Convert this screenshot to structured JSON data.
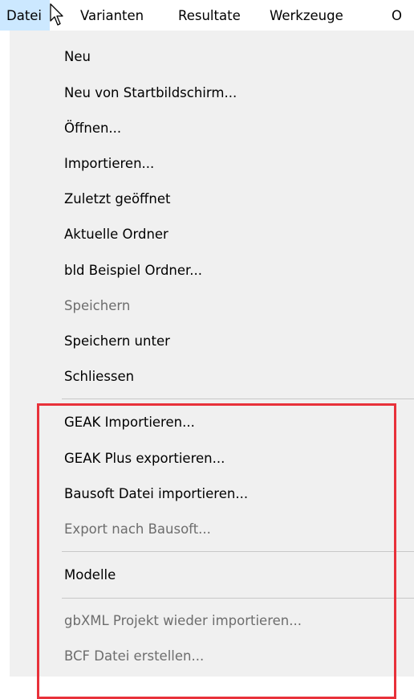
{
  "menubar": {
    "items": [
      {
        "label": "Datei"
      },
      {
        "label": "Varianten"
      },
      {
        "label": "Resultate"
      },
      {
        "label": "Werkzeuge"
      },
      {
        "label": "O"
      }
    ]
  },
  "dropdown": {
    "items": [
      {
        "label": "Neu",
        "enabled": true
      },
      {
        "label": "Neu von Startbildschirm...",
        "enabled": true
      },
      {
        "label": "Öffnen...",
        "enabled": true
      },
      {
        "label": "Importieren...",
        "enabled": true
      },
      {
        "label": "Zuletzt geöffnet",
        "enabled": true
      },
      {
        "label": "Aktuelle Ordner",
        "enabled": true
      },
      {
        "label": "bld Beispiel Ordner...",
        "enabled": true
      },
      {
        "label": "Speichern",
        "enabled": false
      },
      {
        "label": "Speichern unter",
        "enabled": true
      },
      {
        "label": "Schliessen",
        "enabled": true
      },
      {
        "label": "GEAK Importieren...",
        "enabled": true
      },
      {
        "label": "GEAK Plus exportieren...",
        "enabled": true
      },
      {
        "label": "Bausoft Datei importieren...",
        "enabled": true
      },
      {
        "label": "Export nach Bausoft...",
        "enabled": false
      },
      {
        "label": "Modelle",
        "enabled": true
      },
      {
        "label": "gbXML Projekt wieder importieren...",
        "enabled": false
      },
      {
        "label": "BCF Datei erstellen...",
        "enabled": false
      }
    ]
  },
  "colors": {
    "menubar_active": "#cce8ff",
    "menu_background": "#f0f0f0",
    "disabled_text": "#6d6d6d",
    "annotation_box": "#e8313a"
  }
}
